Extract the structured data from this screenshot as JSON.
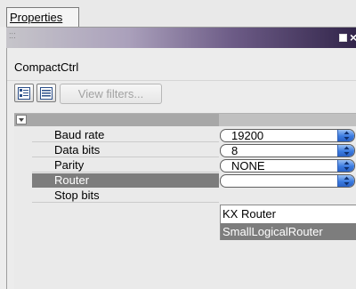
{
  "tab": {
    "label": "Properties"
  },
  "window": {
    "grip_text": "⁚⁚⁚",
    "close_glyph": "×"
  },
  "object": {
    "name": "CompactCtrl"
  },
  "toolbar": {
    "view_filters_label": "View filters..."
  },
  "grid": {
    "rows": [
      {
        "name": "Baud rate",
        "value": "19200"
      },
      {
        "name": "Data bits",
        "value": "8"
      },
      {
        "name": "Parity",
        "value": "NONE"
      },
      {
        "name": "Router",
        "value": ""
      },
      {
        "name": "Stop bits",
        "value": ""
      }
    ],
    "selected_row": "Router"
  },
  "dropdown": {
    "options": [
      "KX Router",
      "SmallLogicalRouter"
    ],
    "hovered": "SmallLogicalRouter"
  },
  "colors": {
    "selection": "#7d7d7d",
    "combo_arrow": "#3b7be0",
    "titlebar_dark": "#32254a"
  }
}
